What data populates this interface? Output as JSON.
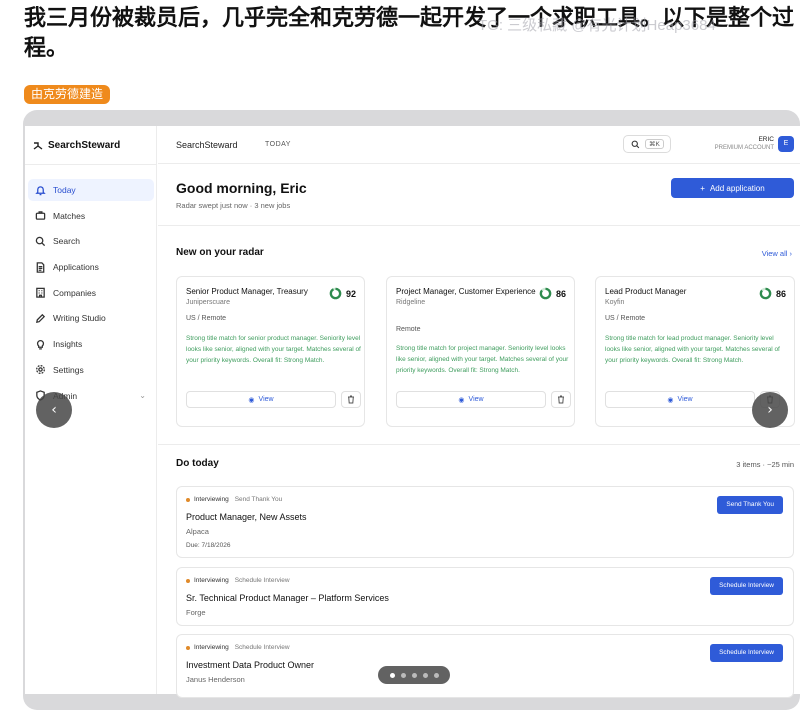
{
  "post": {
    "title": "我三月份被裁员后，几乎完全和克劳德一起开发了一个求职工具。以下是整个过程。",
    "watermark": "TG: 三级私藏 @有光计划Heap3684",
    "tag": "由克劳德建造"
  },
  "sidebar": {
    "brand": "SearchSteward",
    "items": [
      {
        "label": "Today",
        "icon": "bell-icon",
        "active": true
      },
      {
        "label": "Matches",
        "icon": "briefcase-icon"
      },
      {
        "label": "Search",
        "icon": "search-icon"
      },
      {
        "label": "Applications",
        "icon": "document-icon"
      },
      {
        "label": "Companies",
        "icon": "building-icon"
      },
      {
        "label": "Writing Studio",
        "icon": "pen-icon"
      },
      {
        "label": "Insights",
        "icon": "lightbulb-icon"
      },
      {
        "label": "Settings",
        "icon": "gear-icon"
      },
      {
        "label": "Admin",
        "icon": "shield-icon",
        "chevron": true
      }
    ]
  },
  "topbar": {
    "app_name": "SearchSteward",
    "today_label": "TODAY",
    "search_shortcut": "⌘K",
    "user_name": "ERIC",
    "user_plan": "PREMIUM ACCOUNT",
    "avatar_letter": "E"
  },
  "header": {
    "greeting": "Good morning, Eric",
    "subtitle": "Radar swept just now · 3 new jobs",
    "add_button": "Add application"
  },
  "radar": {
    "title": "New on your radar",
    "view_all": "View all",
    "cards": [
      {
        "title": "Senior Product Manager, Treasury",
        "company": "Juniperscuare",
        "score": "92",
        "location": "US / Remote",
        "description": "Strong title match for senior product manager. Seniority level looks like senior, aligned with your target. Matches several of your priority keywords. Overall fit: Strong Match.",
        "view_label": "View"
      },
      {
        "title": "Project Manager, Customer Experience",
        "company": "Ridgeline",
        "score": "86",
        "location": "Remote",
        "description": "Strong title match for project manager. Seniority level looks like senior, aligned with your target. Matches several of your priority keywords. Overall fit: Strong Match.",
        "view_label": "View"
      },
      {
        "title": "Lead Product Manager",
        "company": "Koyfin",
        "score": "86",
        "location": "US / Remote",
        "description": "Strong title match for lead product manager. Seniority level looks like senior, aligned with your target. Matches several of your priority keywords. Overall fit: Strong Match.",
        "view_label": "View"
      }
    ]
  },
  "do_today": {
    "title": "Do today",
    "meta": "3 items · ~25 min",
    "tasks": [
      {
        "status": "Interviewing",
        "step": "Send Thank You",
        "name": "Product Manager, New Assets",
        "company": "Alpaca",
        "due": "Due: 7/18/2026",
        "button": "Send Thank You"
      },
      {
        "status": "Interviewing",
        "step": "Schedule Interview",
        "name": "Sr. Technical Product Manager – Platform Services",
        "company": "Forge",
        "due": "",
        "button": "Schedule Interview"
      },
      {
        "status": "Interviewing",
        "step": "Schedule Interview",
        "name": "Investment Data Product Owner",
        "company": "Janus Henderson",
        "due": "",
        "button": "Schedule Interview"
      }
    ]
  },
  "colors": {
    "accent": "#2f5bd8",
    "tag": "#ef8a1c",
    "match_text": "#3f9d5e",
    "status_dot": "#e08a2a"
  }
}
